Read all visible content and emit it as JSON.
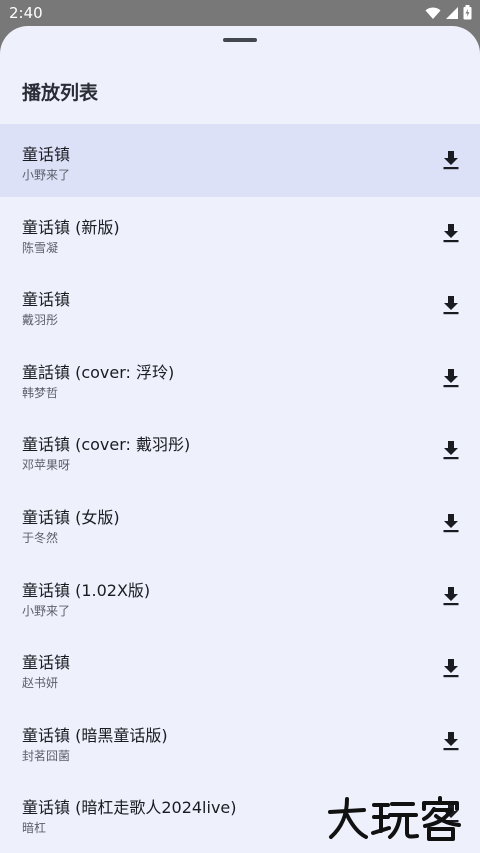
{
  "status": {
    "time": "2:40",
    "icons": [
      "wifi-icon",
      "signal-icon",
      "battery-icon"
    ]
  },
  "sheet": {
    "title": "播放列表"
  },
  "tracks": [
    {
      "title": "童话镇",
      "artist": "小野来了",
      "active": true
    },
    {
      "title": "童话镇 (新版)",
      "artist": "陈雪凝"
    },
    {
      "title": "童话镇",
      "artist": "戴羽彤"
    },
    {
      "title": "童話镇 (cover: 浮玲)",
      "artist": "韩梦哲"
    },
    {
      "title": "童话镇 (cover: 戴羽彤)",
      "artist": "邓苹果呀"
    },
    {
      "title": "童话镇 (女版)",
      "artist": "于冬然"
    },
    {
      "title": "童话镇 (1.02X版)",
      "artist": "小野来了"
    },
    {
      "title": "童话镇",
      "artist": "赵书妍"
    },
    {
      "title": "童话镇 (暗黑童话版)",
      "artist": "封茗囧菌"
    },
    {
      "title": "童话镇 (暗杠走歌人2024live)",
      "artist": "暗杠"
    }
  ],
  "row_icon": "download-icon",
  "colors": {
    "sheet_bg": "#eef0fb",
    "active_row": "#dce1f8",
    "scrim": "#787878"
  },
  "watermark": {
    "text": "大玩客"
  }
}
